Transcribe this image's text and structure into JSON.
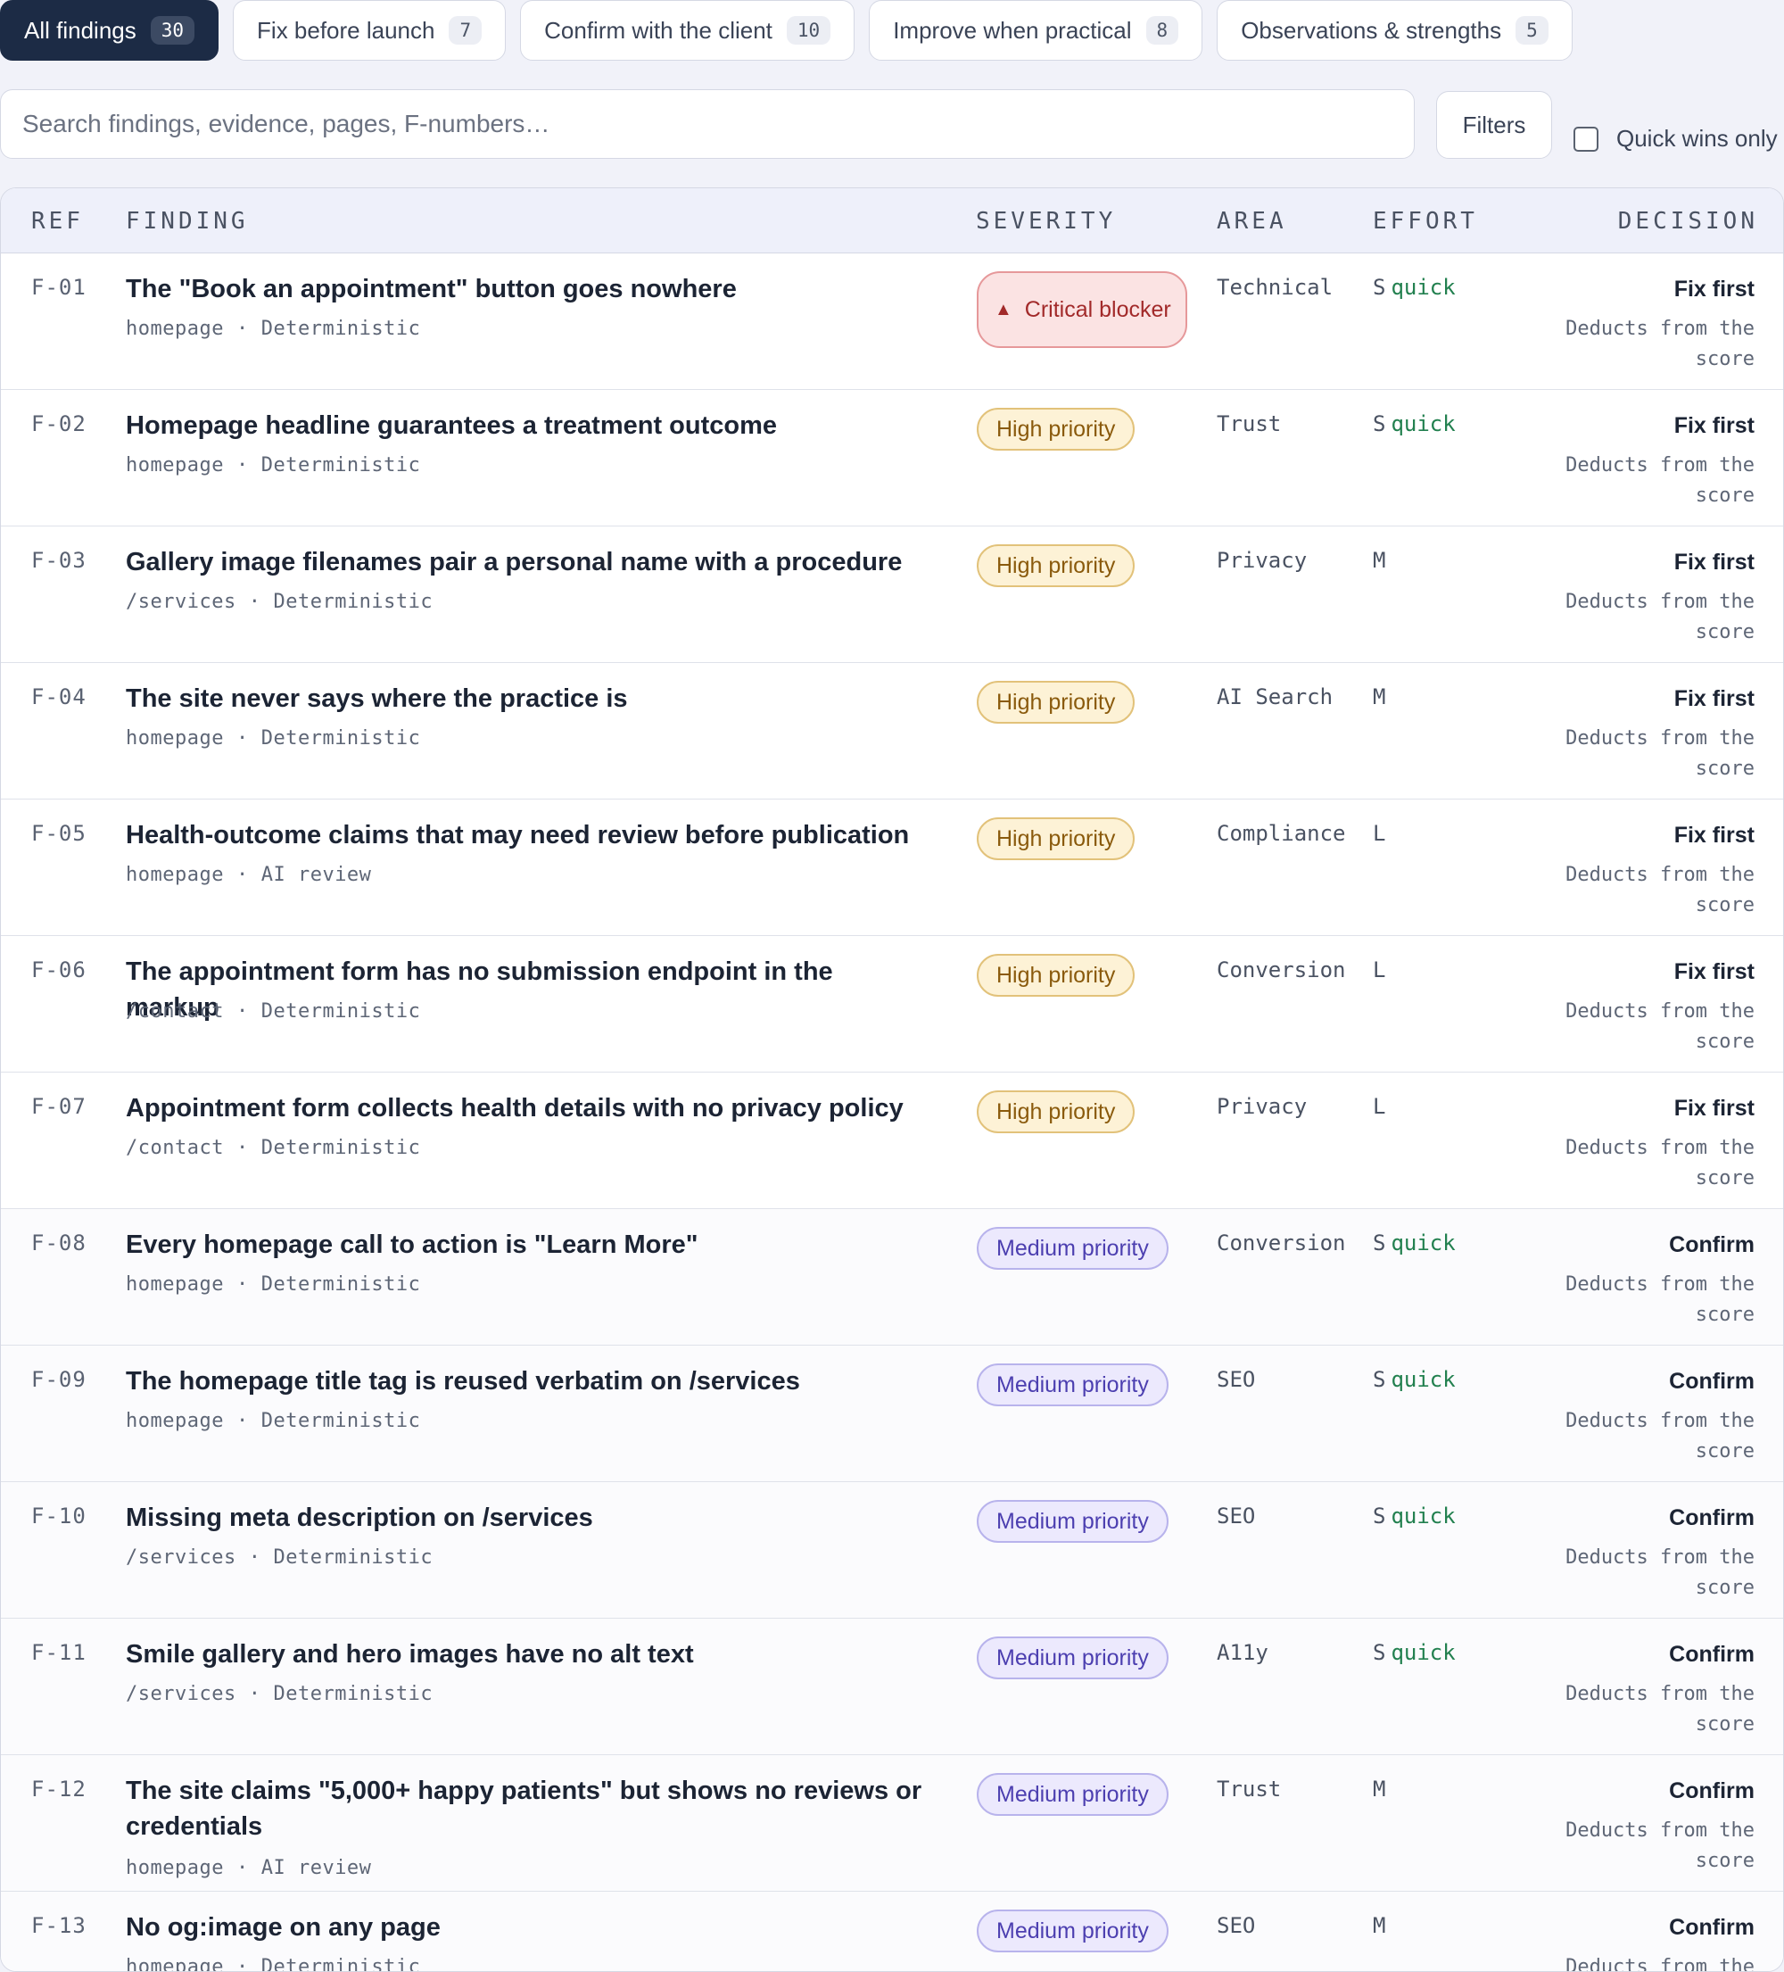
{
  "tabs": [
    {
      "label": "All findings",
      "count": "30"
    },
    {
      "label": "Fix before launch",
      "count": "7"
    },
    {
      "label": "Confirm with the client",
      "count": "10"
    },
    {
      "label": "Improve when practical",
      "count": "8"
    },
    {
      "label": "Observations & strengths",
      "count": "5"
    }
  ],
  "search": {
    "placeholder": "Search findings, evidence, pages, F-numbers…"
  },
  "filters_label": "Filters",
  "quick_wins_label": "Quick wins only",
  "columns": {
    "ref": "REF",
    "finding": "FINDING",
    "severity": "SEVERITY",
    "area": "AREA",
    "effort": "EFFORT",
    "decision": "DECISION"
  },
  "rows": [
    {
      "ref": "F-01",
      "title": "The \"Book an appointment\" button goes nowhere",
      "page": "homepage",
      "method": "Deterministic",
      "severity": "Critical blocker",
      "sev_class": "critical",
      "area": "Technical",
      "effort": "S",
      "quick": "quick",
      "decision": "Fix first",
      "note": "Deducts from the score"
    },
    {
      "ref": "F-02",
      "title": "Homepage headline guarantees a treatment outcome",
      "page": "homepage",
      "method": "Deterministic",
      "severity": "High priority",
      "sev_class": "high",
      "area": "Trust",
      "effort": "S",
      "quick": "quick",
      "decision": "Fix first",
      "note": "Deducts from the score"
    },
    {
      "ref": "F-03",
      "title": "Gallery image filenames pair a personal name with a procedure",
      "page": "/services",
      "method": "Deterministic",
      "severity": "High priority",
      "sev_class": "high",
      "area": "Privacy",
      "effort": "M",
      "quick": "",
      "decision": "Fix first",
      "note": "Deducts from the score"
    },
    {
      "ref": "F-04",
      "title": "The site never says where the practice is",
      "page": "homepage",
      "method": "Deterministic",
      "severity": "High priority",
      "sev_class": "high",
      "area": "AI Search",
      "effort": "M",
      "quick": "",
      "decision": "Fix first",
      "note": "Deducts from the score"
    },
    {
      "ref": "F-05",
      "title": "Health-outcome claims that may need review before publication",
      "page": "homepage",
      "method": "AI review",
      "severity": "High priority",
      "sev_class": "high",
      "area": "Compliance",
      "effort": "L",
      "quick": "",
      "decision": "Fix first",
      "note": "Deducts from the score"
    },
    {
      "ref": "F-06",
      "title": "The appointment form has no submission endpoint in the markup",
      "page": "/contact",
      "method": "Deterministic",
      "severity": "High priority",
      "sev_class": "high",
      "area": "Conversion",
      "effort": "L",
      "quick": "",
      "decision": "Fix first",
      "note": "Deducts from the score"
    },
    {
      "ref": "F-07",
      "title": "Appointment form collects health details with no privacy policy",
      "page": "/contact",
      "method": "Deterministic",
      "severity": "High priority",
      "sev_class": "high",
      "area": "Privacy",
      "effort": "L",
      "quick": "",
      "decision": "Fix first",
      "note": "Deducts from the score"
    },
    {
      "ref": "F-08",
      "title": "Every homepage call to action is \"Learn More\"",
      "page": "homepage",
      "method": "Deterministic",
      "severity": "Medium priority",
      "sev_class": "medium",
      "area": "Conversion",
      "effort": "S",
      "quick": "quick",
      "decision": "Confirm",
      "note": "Deducts from the score"
    },
    {
      "ref": "F-09",
      "title": "The homepage title tag is reused verbatim on /services",
      "page": "homepage",
      "method": "Deterministic",
      "severity": "Medium priority",
      "sev_class": "medium",
      "area": "SEO",
      "effort": "S",
      "quick": "quick",
      "decision": "Confirm",
      "note": "Deducts from the score"
    },
    {
      "ref": "F-10",
      "title": "Missing meta description on /services",
      "page": "/services",
      "method": "Deterministic",
      "severity": "Medium priority",
      "sev_class": "medium",
      "area": "SEO",
      "effort": "S",
      "quick": "quick",
      "decision": "Confirm",
      "note": "Deducts from the score"
    },
    {
      "ref": "F-11",
      "title": "Smile gallery and hero images have no alt text",
      "page": "/services",
      "method": "Deterministic",
      "severity": "Medium priority",
      "sev_class": "medium",
      "area": "A11y",
      "effort": "S",
      "quick": "quick",
      "decision": "Confirm",
      "note": "Deducts from the score"
    },
    {
      "ref": "F-12",
      "title": "The site claims \"5,000+ happy patients\" but shows no reviews or credentials",
      "page": "homepage",
      "method": "AI review",
      "severity": "Medium priority",
      "sev_class": "medium",
      "area": "Trust",
      "effort": "M",
      "quick": "",
      "decision": "Confirm",
      "note": "Deducts from the score"
    },
    {
      "ref": "F-13",
      "title": "No og:image on any page",
      "page": "homepage",
      "method": "Deterministic",
      "severity": "Medium priority",
      "sev_class": "medium",
      "area": "SEO",
      "effort": "M",
      "quick": "",
      "decision": "Confirm",
      "note": "Deducts from the score"
    }
  ]
}
